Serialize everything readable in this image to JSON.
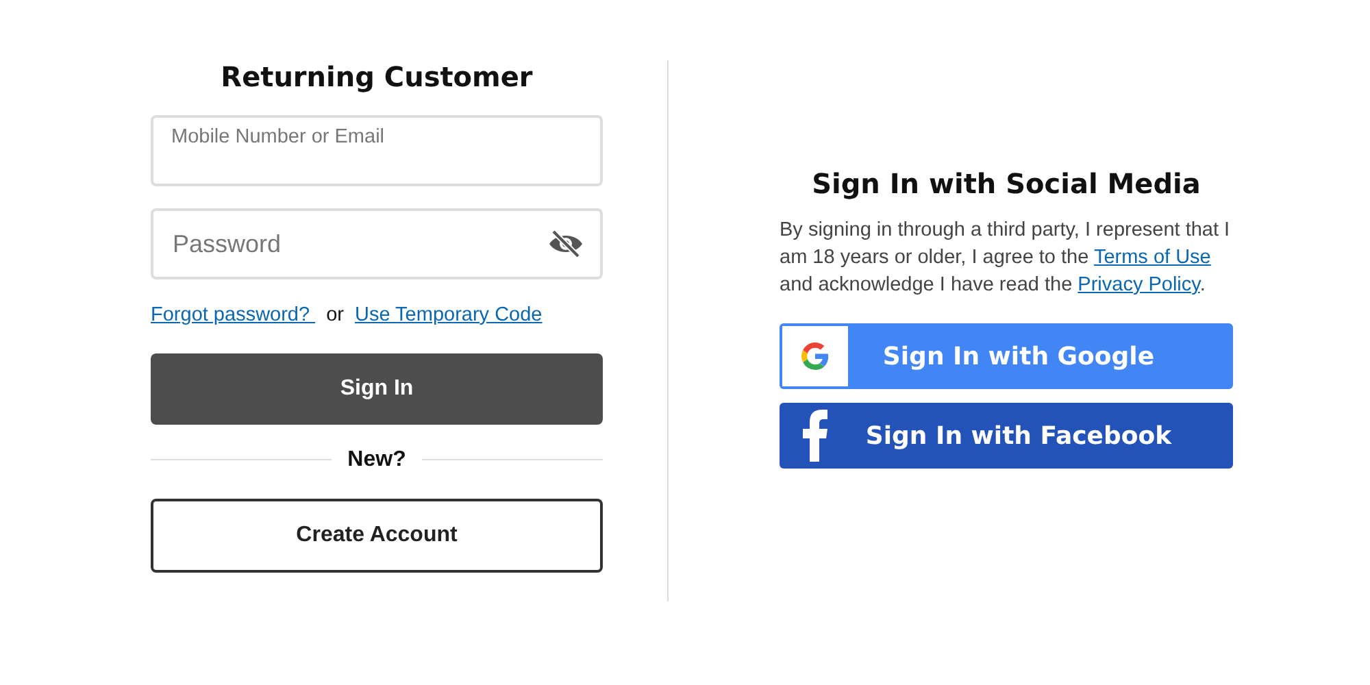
{
  "returning": {
    "title": "Returning Customer",
    "email": {
      "placeholder": "Mobile Number or Email"
    },
    "password": {
      "placeholder": "Password",
      "visible": false
    },
    "links": [
      {
        "kind": "link",
        "text": "Forgot password? "
      },
      {
        "kind": "text",
        "text": "or"
      },
      {
        "kind": "link",
        "text": "Use Temporary Code"
      }
    ],
    "sign_in": "Sign In",
    "new_label": "New?",
    "create_account": "Create Account"
  },
  "social": {
    "title": "Sign In with Social Media",
    "consent": [
      {
        "kind": "text",
        "text": "By signing in through a third party, I represent that I am 18 years or older, I agree to the "
      },
      {
        "kind": "link",
        "text": "Terms of Use"
      },
      {
        "kind": "text",
        "text": " and acknowledge I have read the "
      },
      {
        "kind": "link",
        "text": "Privacy Policy"
      },
      {
        "kind": "text",
        "text": "."
      }
    ],
    "buttons": [
      {
        "kind": "google",
        "label": "Sign In with Google",
        "color": "#4285f4"
      },
      {
        "kind": "facebook",
        "label": "Sign In with Facebook",
        "color": "#2353b8"
      }
    ]
  }
}
